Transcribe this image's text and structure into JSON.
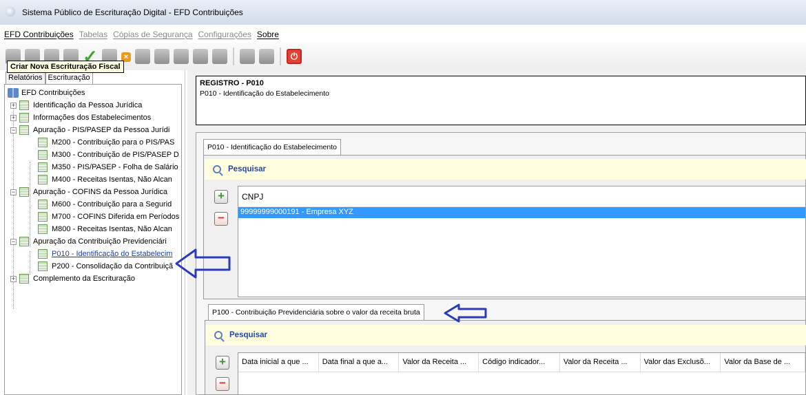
{
  "window": {
    "title": "Sistema Público de Escrituração Digital - EFD Contribuições"
  },
  "menu": [
    {
      "label": "EFD Contribuições",
      "enabled": true
    },
    {
      "label": "Tabelas",
      "enabled": false
    },
    {
      "label": "Cópias de Segurança",
      "enabled": false
    },
    {
      "label": "Configurações",
      "enabled": false
    },
    {
      "label": "Sobre",
      "enabled": true
    }
  ],
  "toolbar": {
    "tooltip": "Criar Nova Escrituração Fiscal"
  },
  "left_tabs": [
    "Relatórios",
    "Escrituração"
  ],
  "tree": {
    "root": "EFD Contribuições",
    "items": [
      "Identificação da Pessoa Jurídica",
      "Informações dos Estabelecimentos",
      "Apuração - PIS/PASEP da Pessoa Jurídi",
      "M200 - Contribuição para o PIS/PAS",
      "M300 - Contribuição de PIS/PASEP D",
      "M350 - PIS/PASEP - Folha de Salário",
      "M400 - Receitas Isentas, Não Alcan",
      "Apuração - COFINS da Pessoa Jurídica",
      "M600 - Contribuição para a Segurid",
      "M700 - COFINS Diferida em Períodos",
      "M800 - Receitas Isentas, Não Alcan",
      "Apuração da Contribuição Previdenciári",
      "P010 - Identificação do Estabelecim",
      "P200 - Consolidação da Contribuiçã",
      "Complemento da Escrituração"
    ]
  },
  "register": {
    "title": "REGISTRO - P010",
    "subtitle": "P010 - Identificação do Estabelecimento"
  },
  "p010": {
    "tab": "P010 - Identificação do Estabelecimento",
    "search": "Pesquisar",
    "column": "CNPJ",
    "row": "99999999000191 - Empresa XYZ"
  },
  "p100": {
    "tab": "P100 - Contribuição Previdenciária sobre o valor da receita bruta",
    "search": "Pesquisar",
    "columns": [
      "Data inicial a que ...",
      "Data final a que a...",
      "Valor da Receita ...",
      "Código indicador...",
      "Valor da Receita ...",
      "Valor das Exclusõ...",
      "Valor da Base de ..."
    ]
  },
  "colors": {
    "selection": "#3399ff",
    "search_bg": "#ffffe0",
    "annotation_arrow": "#2a3bb8"
  }
}
